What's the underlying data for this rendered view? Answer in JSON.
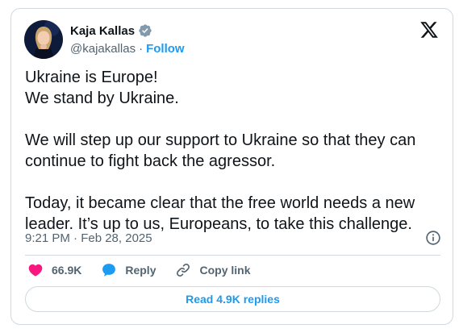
{
  "author": {
    "display_name": "Kaja Kallas",
    "handle": "@kajakallas",
    "separator": "·",
    "follow_label": "Follow",
    "verified_icon": "verified-badge-icon"
  },
  "brand_icon": "x-logo-icon",
  "tweet": {
    "paragraphs": [
      "Ukraine is Europe!\nWe stand by Ukraine.",
      "We will step up our support to Ukraine so that they can\ncontinue to fight back the agressor.",
      "Today, it became clear that the free world needs a new\nleader. It’s up to us, Europeans, to take this challenge."
    ],
    "timestamp": "9:21 PM · Feb 28, 2025"
  },
  "actions": {
    "likes": "66.9K",
    "reply_label": "Reply",
    "copy_link_label": "Copy link"
  },
  "read_replies_label": "Read 4.9K replies",
  "colors": {
    "accent": "#1d9bf0",
    "like": "#f91880",
    "text": "#0f1419",
    "muted": "#536471",
    "border": "#cfd9de"
  }
}
